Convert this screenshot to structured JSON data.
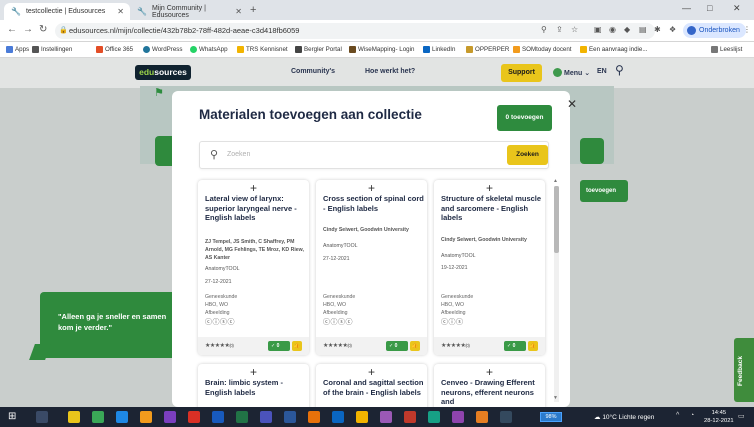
{
  "browser": {
    "tabs": [
      {
        "label": "testcollectie | Edusources",
        "active": true
      },
      {
        "label": "Mijn Community | Edusources",
        "active": false
      }
    ],
    "url": "edusources.nl/mijn/collectie/432b78b2-78ff-482d-aeae-c3d418fb6059",
    "profile_label": "Onderbroken",
    "bookmarks": [
      {
        "label": "Apps",
        "color": "#4a7bd8"
      },
      {
        "label": "Instellingen",
        "color": "#555555"
      },
      {
        "label": "Office 365",
        "color": "#e34d26"
      },
      {
        "label": "WordPress",
        "color": "#21759b"
      },
      {
        "label": "WhatsApp",
        "color": "#25d366"
      },
      {
        "label": "TRS Kennisnet",
        "color": "#f2b400"
      },
      {
        "label": "Bergler Portal",
        "color": "#444444"
      },
      {
        "label": "WiseMapping- Login",
        "color": "#6a4a1f"
      },
      {
        "label": "LinkedIn",
        "color": "#0a66c2"
      },
      {
        "label": "OPPERPER",
        "color": "#c79a2b"
      },
      {
        "label": "SOMtoday docent",
        "color": "#f29b1d"
      },
      {
        "label": "Een aanvraag indie...",
        "color": "#f2b400"
      }
    ],
    "reading_list": "Leeslijst"
  },
  "site": {
    "logo_prefix": "edu",
    "logo_suffix": "sources",
    "nav": [
      "Community's",
      "Hoe werkt het?"
    ],
    "support_label": "Support",
    "menu_label": "Menu ⌄",
    "lang_label": "EN",
    "bg_button_label": "toevoegen",
    "quote": "\"Alleen ga je sneller en samen kom je verder.\"",
    "feedback_label": "Feedback"
  },
  "modal": {
    "title": "Materialen toevoegen aan collectie",
    "count_button": "0 toevoegen",
    "search_placeholder": "Zoeken",
    "search_button": "Zoeken",
    "cards": [
      {
        "title": "Lateral view of larynx: superior laryngeal nerve - English labels",
        "authors": "ZJ Tempel, JS Smith, C Shaffrey, PM Arnold, MG Fehlings, TE Mroz, KD Riew, AS Kanter",
        "publisher": "AnatomyTOOL",
        "date": "27-12-2021",
        "discipline": "Geneeskunde",
        "level": "HBO, WO",
        "type": "Afbeelding",
        "license_icons": "ⓒⓘⓢⓒ",
        "stars": "★★★★★",
        "rating_count": "(0)",
        "count": "0"
      },
      {
        "title": "Cross section of spinal cord - English labels",
        "authors": "Cindy Seiwert, Goodwin University",
        "publisher": "AnatomyTOOL",
        "date": "27-12-2021",
        "discipline": "Geneeskunde",
        "level": "HBO, WO",
        "type": "Afbeelding",
        "license_icons": "ⓒⓘⓢⓒ",
        "stars": "★★★★★",
        "rating_count": "(0)",
        "count": "0"
      },
      {
        "title": "Structure of skeletal muscle and sarcomere - English labels",
        "authors": "Cindy Seiwert, Goodwin University",
        "publisher": "AnatomyTOOL",
        "date": "19-12-2021",
        "discipline": "Geneeskunde",
        "level": "HBO, WO",
        "type": "Afbeelding",
        "license_icons": "ⓒⓘⓢ",
        "stars": "★★★★★",
        "rating_count": "(0)",
        "count": "0"
      }
    ],
    "cards_row2": [
      {
        "title": "Brain: limbic system - English labels"
      },
      {
        "title": "Coronal and sagittal section of the brain - English labels"
      },
      {
        "title": "Cenveo - Drawing Efferent neurons, efferent neurons and"
      }
    ]
  },
  "taskbar": {
    "battery": "98%",
    "weather": "10°C Lichte regen",
    "time": "14:45",
    "date": "28-12-2021"
  }
}
